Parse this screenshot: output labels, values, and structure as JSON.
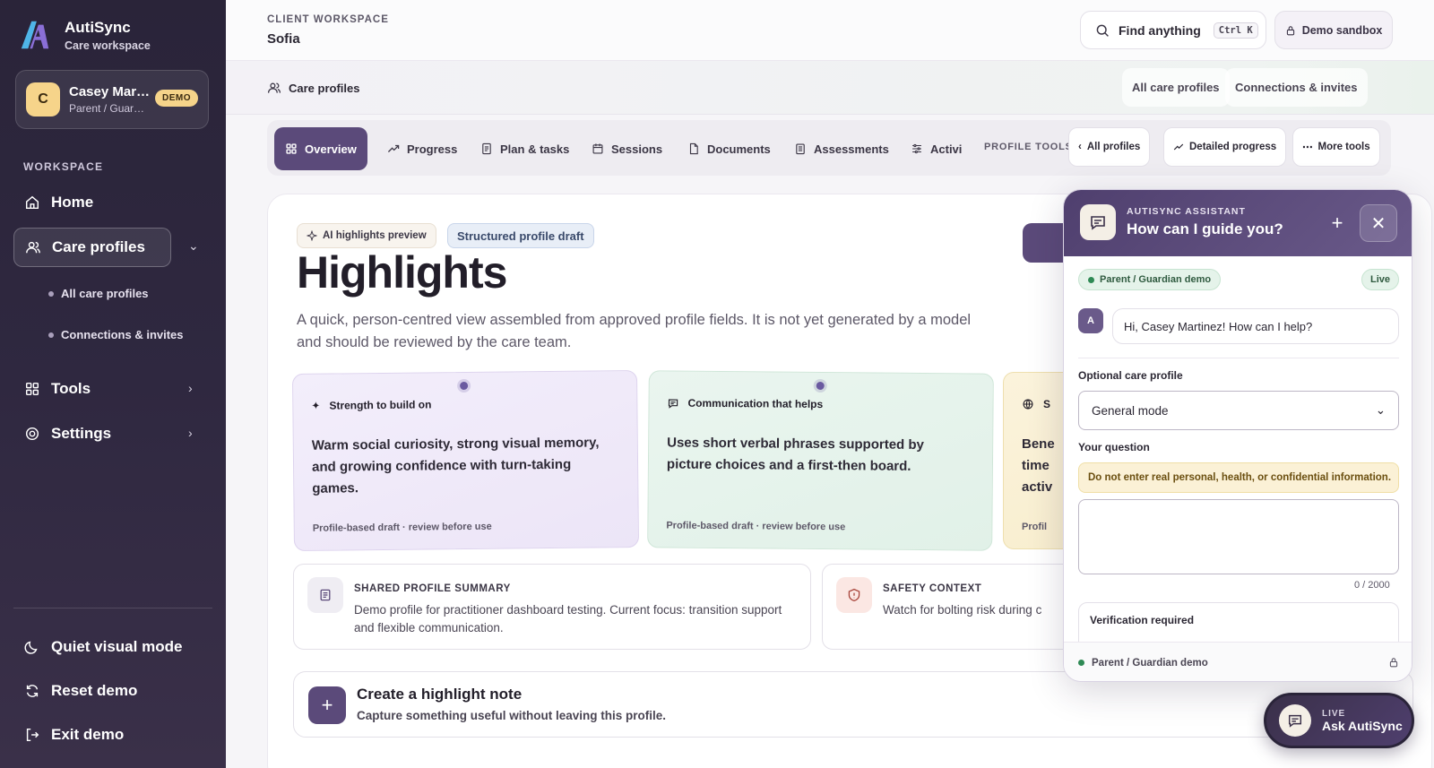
{
  "brand": {
    "name": "AutiSync",
    "subtitle": "Care workspace"
  },
  "user": {
    "initial": "C",
    "name": "Casey Martinez",
    "role": "Parent / Guardian demo",
    "badge": "DEMO"
  },
  "sidebar": {
    "section_label": "WORKSPACE",
    "items": [
      {
        "label": "Home",
        "icon": "home-icon"
      },
      {
        "label": "Care profiles",
        "icon": "users-icon",
        "active": true
      },
      {
        "label": "Tools",
        "icon": "grid-icon"
      },
      {
        "label": "Settings",
        "icon": "gear-icon"
      }
    ],
    "sub_items": [
      "All care profiles",
      "Connections & invites"
    ],
    "bottom": [
      {
        "label": "Quiet visual mode",
        "icon": "moon-icon"
      },
      {
        "label": "Reset demo",
        "icon": "refresh-icon"
      },
      {
        "label": "Exit demo",
        "icon": "exit-icon"
      }
    ]
  },
  "topbar": {
    "label": "CLIENT WORKSPACE",
    "client": "Sofia",
    "search_label": "Find anything",
    "shortcut": "Ctrl K",
    "sandbox_label": "Demo sandbox"
  },
  "subbar": {
    "title": "Care profiles",
    "links": [
      "All care profiles",
      "Connections & invites"
    ]
  },
  "tabs": {
    "items": [
      "Overview",
      "Progress",
      "Plan & tasks",
      "Sessions",
      "Documents",
      "Assessments",
      "Activi"
    ],
    "active": "Overview",
    "tools_label": "PROFILE TOOLS",
    "tools": [
      "All profiles",
      "Detailed progress",
      "More tools"
    ]
  },
  "main": {
    "chip_ai": "AI highlights preview",
    "chip_draft": "Structured profile draft",
    "title": "Highlights",
    "lead": "A quick, person-centred view assembled from approved profile fields. It is not yet generated by a model and should be reviewed by the care team.",
    "cards": [
      {
        "head": "Strength to build on",
        "body": "Warm social curiosity, strong visual memory, and growing confidence with turn-taking games.",
        "foot": "Profile-based draft · review before use"
      },
      {
        "head": "Communication that helps",
        "body": "Uses short verbal phrases supported by picture choices and a first-then board.",
        "foot": "Profile-based draft · review before use"
      },
      {
        "head": "S",
        "body": "Bene time activ",
        "foot": "Profil"
      }
    ],
    "summary": {
      "title": "SHARED PROFILE SUMMARY",
      "text": "Demo profile for practitioner dashboard testing. Current focus: transition support and flexible communication."
    },
    "safety": {
      "title": "SAFETY CONTEXT",
      "text": "Watch for bolting risk during c"
    },
    "create": {
      "title": "Create a highlight note",
      "subtitle": "Capture something useful without leaving this profile."
    }
  },
  "assistant": {
    "label": "AUTISYNC ASSISTANT",
    "title": "How can I guide you?",
    "role_pill": "Parent / Guardian demo",
    "live": "Live",
    "avatar": "A",
    "greeting": "Hi, Casey Martinez! How can I help?",
    "profile_label": "Optional care profile",
    "profile_value": "General mode",
    "question_label": "Your question",
    "warning": "Do not enter real personal, health, or confidential information.",
    "counter": "0 / 2000",
    "verify": "Verification required",
    "footer": "Parent / Guardian demo"
  },
  "live_button": {
    "label": "LIVE",
    "text": "Ask AutiSync"
  }
}
